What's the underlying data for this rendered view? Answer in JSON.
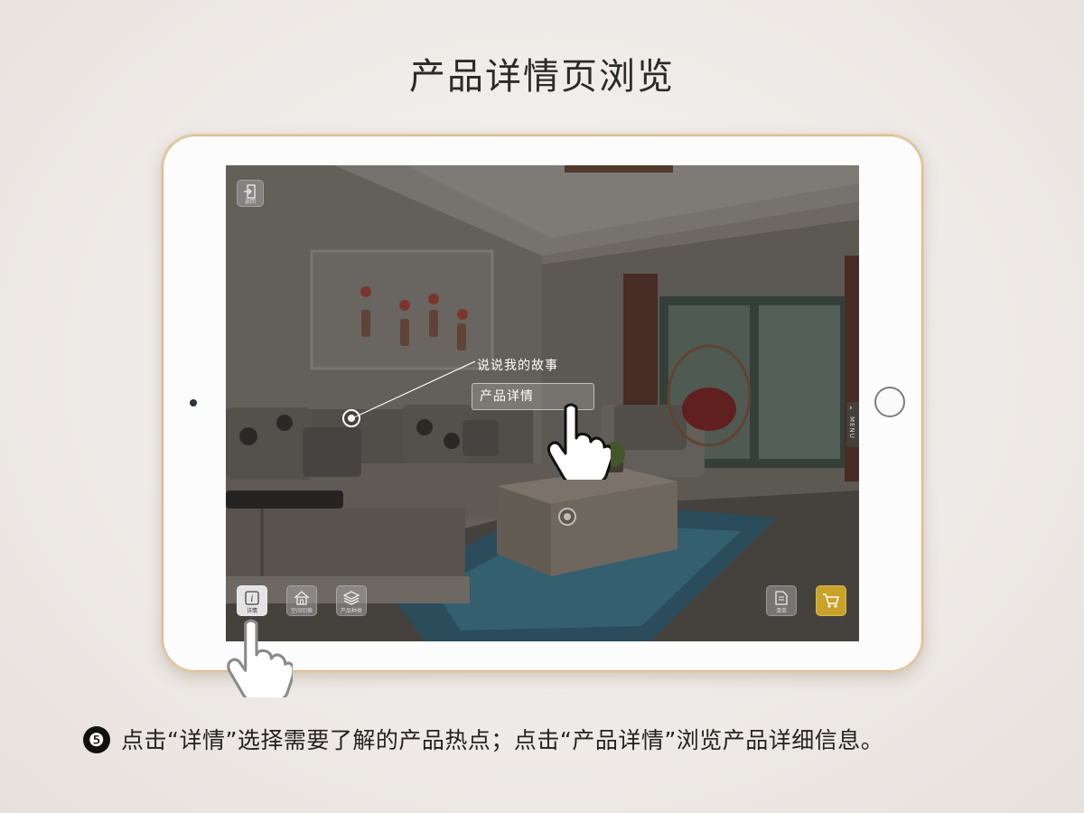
{
  "page": {
    "title": "产品详情页浏览",
    "step_number": "❺",
    "caption": "点击“详情”选择需要了解的产品热点；点击“产品详情”浏览产品详细信息。"
  },
  "app": {
    "top_left_button": {
      "label": "返回",
      "icon": "exit-door-icon"
    },
    "toolbar_left": [
      {
        "key": "details",
        "label": "详情",
        "icon": "info-icon",
        "active": true
      },
      {
        "key": "space",
        "label": "空间切换",
        "icon": "house-icon",
        "active": false
      },
      {
        "key": "product_type",
        "label": "产品种类",
        "icon": "layers-icon",
        "active": false
      }
    ],
    "toolbar_right": [
      {
        "key": "list",
        "label": "清单",
        "icon": "document-icon"
      },
      {
        "key": "cart",
        "label": "",
        "icon": "cart-icon",
        "color": "#c9a227"
      }
    ],
    "hotspot_popup": {
      "story_label": "说说我的故事",
      "detail_label": "产品详情"
    },
    "side_menu_label": "MENU"
  },
  "colors": {
    "tablet_frame": "#e3c9a4",
    "cart_accent": "#c9a227",
    "screen_overlay": "#5e5a55"
  }
}
